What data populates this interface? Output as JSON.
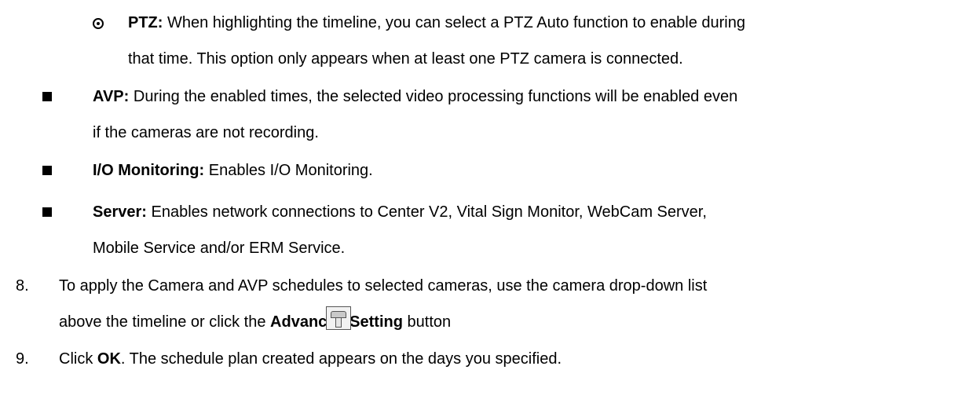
{
  "ptz": {
    "label": "PTZ:",
    "line1": " When highlighting the timeline, you can select a PTZ Auto function to enable during",
    "line2": "that time. This option only appears when at least one PTZ camera is connected."
  },
  "avp": {
    "label": "AVP:",
    "line1": " During the enabled times, the selected video processing functions will be enabled even",
    "line2": "if the cameras are not recording."
  },
  "io": {
    "label": "I/O Monitoring:",
    "line1": " Enables I/O Monitoring."
  },
  "server": {
    "label": "Server:",
    "line1": " Enables network connections to Center V2, Vital Sign Monitor, WebCam Server,",
    "line2": "Mobile Service and/or ERM Service."
  },
  "step8": {
    "number": "8.",
    "line1": "To apply the Camera and AVP schedules to selected cameras, use the camera drop-down list",
    "line2_pre": "above the timeline or click the ",
    "line2_bold": "Advanced Setting",
    "line2_post": " button",
    "line2_end": ".",
    "icon": "advanced-setting-icon"
  },
  "step9": {
    "number": "9.",
    "pre": "Click ",
    "bold": "OK",
    "post": ". The schedule plan created appears on the days you specified."
  }
}
